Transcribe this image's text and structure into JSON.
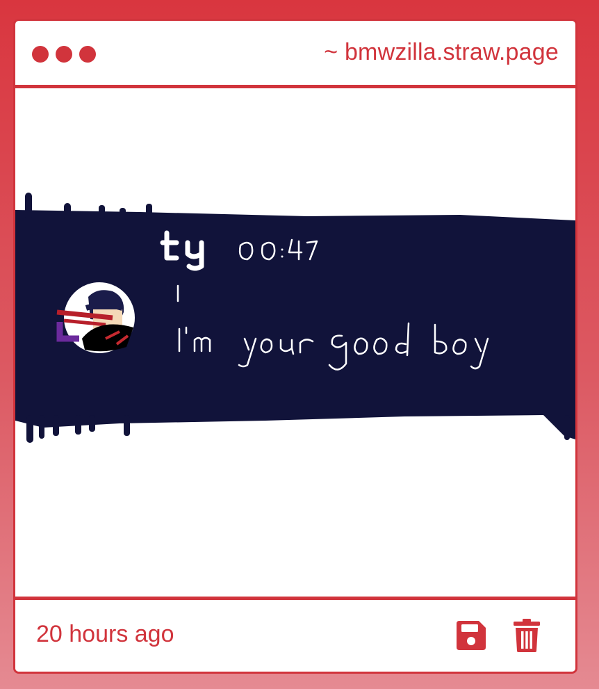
{
  "window": {
    "controls": [
      "dot",
      "dot",
      "dot"
    ],
    "site_url": "~ bmwzilla.straw.page"
  },
  "drawing": {
    "username": "ty",
    "time": "00:47",
    "message": "I'm your good boy",
    "colors": {
      "banner": "#11133a",
      "ink": "#ffffff"
    }
  },
  "footer": {
    "timestamp": "20 hours ago",
    "save_icon": "floppy-disk-icon",
    "delete_icon": "trash-icon"
  },
  "theme": {
    "accent": "#d1343c"
  }
}
